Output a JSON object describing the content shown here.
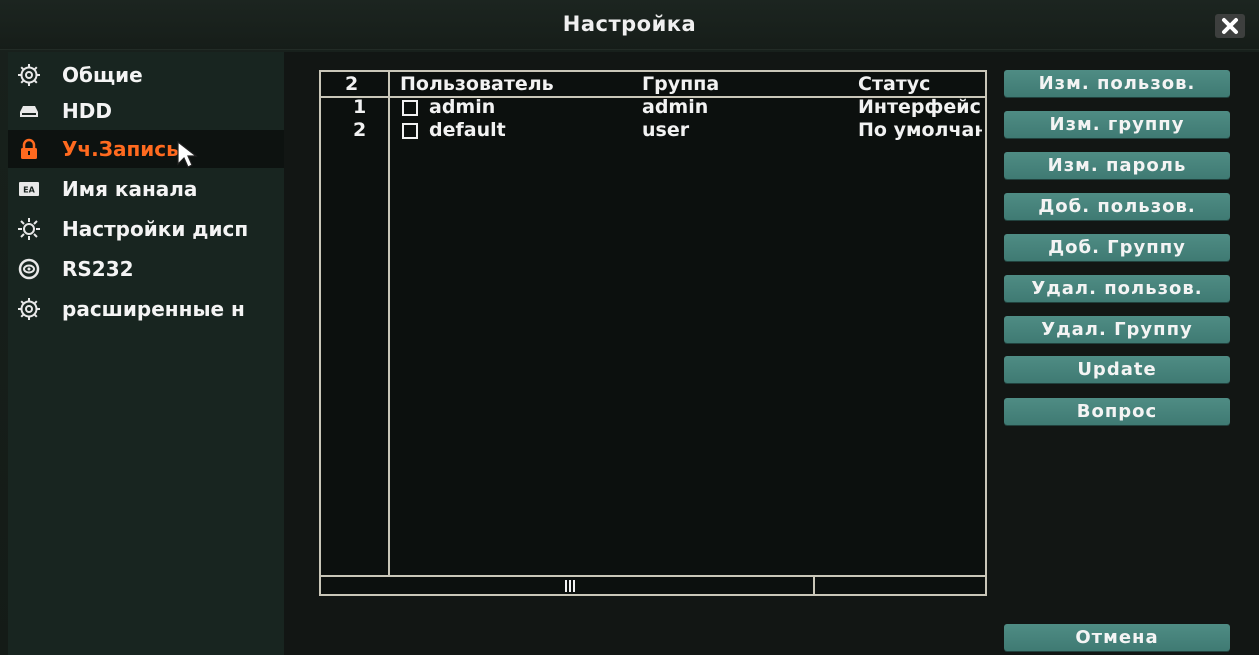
{
  "window": {
    "title": "Настройка"
  },
  "sidebar": {
    "items": [
      {
        "label": "Общие",
        "icon": "gear-icon",
        "active": false
      },
      {
        "label": "HDD",
        "icon": "hdd-icon",
        "active": false
      },
      {
        "label": "Уч.Запись",
        "icon": "lock-icon",
        "active": true
      },
      {
        "label": "Имя канала",
        "icon": "channel-name-icon",
        "active": false
      },
      {
        "label": "Настройки дисп",
        "icon": "brightness-icon",
        "active": false
      },
      {
        "label": "RS232",
        "icon": "rs232-icon",
        "active": false
      },
      {
        "label": "расширенные н",
        "icon": "gear-icon",
        "active": false
      }
    ]
  },
  "user_table": {
    "count": "2",
    "columns": [
      "Пользователь",
      "Группа",
      "Статус"
    ],
    "rows": [
      {
        "index": "1",
        "user": "admin",
        "group": "admin",
        "status": "Интерфейс"
      },
      {
        "index": "2",
        "user": "default",
        "group": "user",
        "status": "По умолчанию"
      }
    ],
    "scroll_position": 0
  },
  "actions": {
    "modify_user": "Изм. пользов.",
    "modify_group": "Изм. группу",
    "modify_password": "Изм. пароль",
    "add_user": "Доб. пользов.",
    "add_group": "Доб. Группу",
    "delete_user": "Удал. пользов.",
    "delete_group": "Удал. Группу",
    "update": "Update",
    "question": "Вопрос",
    "cancel": "Отмена"
  },
  "colors": {
    "accent_active": "#ff6a1f",
    "button": "#4f8c84",
    "border": "#c9c6b8"
  }
}
